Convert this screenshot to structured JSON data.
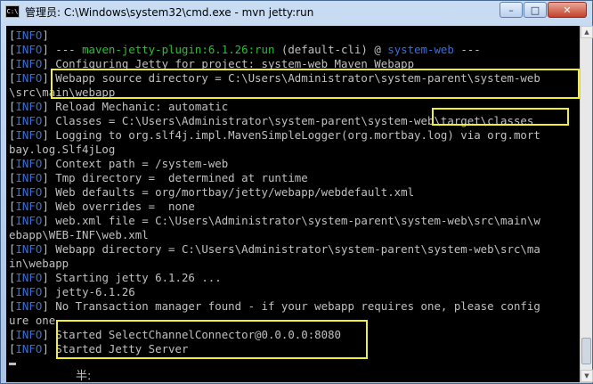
{
  "window": {
    "title": "管理员: C:\\Windows\\system32\\cmd.exe - mvn  jetty:run",
    "icon_text": "C:\\",
    "controls": {
      "minimize": "–",
      "maximize": "□",
      "close": "✕"
    }
  },
  "console": {
    "lines": [
      {
        "prefix": "[",
        "tag": "INFO",
        "rest": "]"
      },
      {
        "prefix": "[",
        "tag": "INFO",
        "rest": "] --- ",
        "plugin": "maven-jetty-plugin:6.1.26:run",
        "mid": " (default-cli) @ ",
        "project": "system-web",
        "tail": " ---"
      },
      {
        "prefix": "[",
        "tag": "INFO",
        "rest": "] Configuring Jetty for project: system-web Maven Webapp"
      },
      {
        "prefix": "[",
        "tag": "INFO",
        "rest": "] Webapp source directory = C:\\Users\\Administrator\\system-parent\\system-web"
      },
      {
        "text": "\\src\\main\\webapp"
      },
      {
        "prefix": "[",
        "tag": "INFO",
        "rest": "] Reload Mechanic: automatic"
      },
      {
        "prefix": "[",
        "tag": "INFO",
        "rest": "] Classes = C:\\Users\\Administrator\\system-parent\\system-web\\target\\classes"
      },
      {
        "prefix": "[",
        "tag": "INFO",
        "rest": "] Logging to org.slf4j.impl.MavenSimpleLogger(org.mortbay.log) via org.mort"
      },
      {
        "text": "bay.log.Slf4jLog"
      },
      {
        "prefix": "[",
        "tag": "INFO",
        "rest": "] Context path = /system-web"
      },
      {
        "prefix": "[",
        "tag": "INFO",
        "rest": "] Tmp directory =  determined at runtime"
      },
      {
        "prefix": "[",
        "tag": "INFO",
        "rest": "] Web defaults = org/mortbay/jetty/webapp/webdefault.xml"
      },
      {
        "prefix": "[",
        "tag": "INFO",
        "rest": "] Web overrides =  none"
      },
      {
        "prefix": "[",
        "tag": "INFO",
        "rest": "] web.xml file = C:\\Users\\Administrator\\system-parent\\system-web\\src\\main\\w"
      },
      {
        "text": "ebapp\\WEB-INF\\web.xml"
      },
      {
        "prefix": "[",
        "tag": "INFO",
        "rest": "] Webapp directory = C:\\Users\\Administrator\\system-parent\\system-web\\src\\ma"
      },
      {
        "text": "in\\webapp"
      },
      {
        "prefix": "[",
        "tag": "INFO",
        "rest": "] Starting jetty 6.1.26 ..."
      },
      {
        "prefix": "[",
        "tag": "INFO",
        "rest": "] jetty-6.1.26"
      },
      {
        "prefix": "[",
        "tag": "INFO",
        "rest": "] No Transaction manager found - if your webapp requires one, please config"
      },
      {
        "text": "ure one"
      },
      {
        "prefix": "[",
        "tag": "INFO",
        "rest": "] Started SelectChannelConnector@0.0.0.0:8080"
      },
      {
        "prefix": "[",
        "tag": "INFO",
        "rest": "] Started Jetty Server"
      }
    ],
    "ime_indicator": "半:"
  },
  "colors": {
    "info_tag": "#3a6fd6",
    "plugin": "#21c431",
    "highlight_box": "#f2ef2e",
    "text": "#c0c0c0",
    "background": "#000000"
  }
}
